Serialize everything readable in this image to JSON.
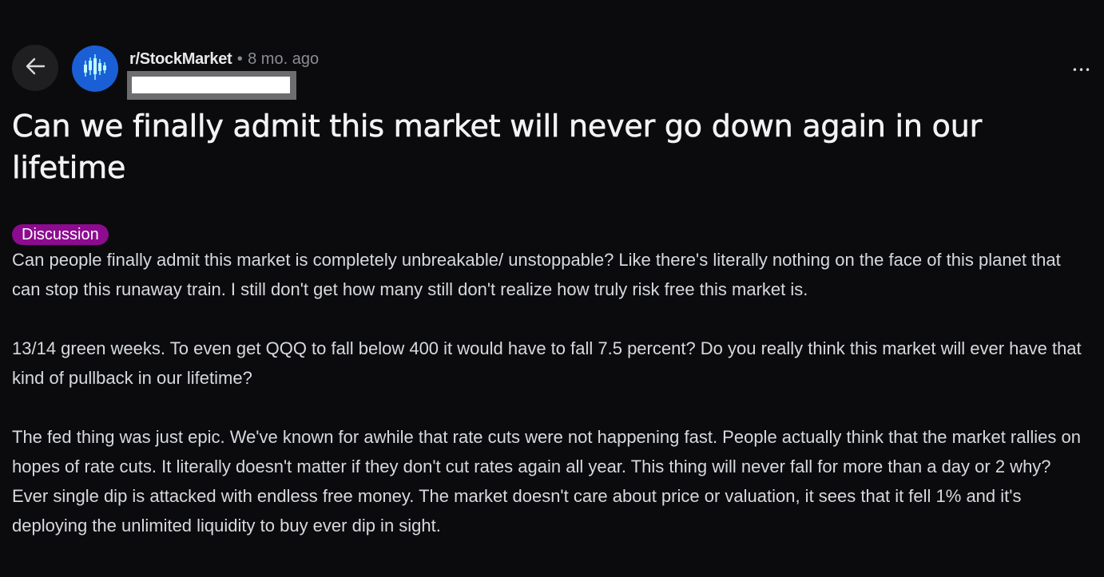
{
  "post": {
    "subreddit": "r/StockMarket",
    "separator": "•",
    "age": "8 mo. ago",
    "more_label": "•••",
    "title": "Can we finally admit this market will never go down again in our lifetime",
    "flair": "Discussion",
    "paragraphs": [
      "Can people finally admit this market is completely unbreakable/ unstoppable? Like there's literally nothing on the face of this planet that can stop this runaway train. I still don't get how many still don't realize how truly risk free this market is.",
      "13/14 green weeks. To even get QQQ to fall below 400 it would have to fall 7.5 percent? Do you really think this market will ever have that kind of pullback in our lifetime?",
      "The fed thing was just epic. We've known for awhile that rate cuts were not happening fast. People actually think that the market rallies on hopes of rate cuts. It literally doesn't matter if they don't cut rates again all year. This thing will never fall for more than a day or 2 why? Ever single dip is attacked with endless free money. The market doesn't care about price or valuation, it sees that it fell 1% and it's deploying the unlimited liquidity to buy ever dip in sight."
    ]
  },
  "icons": {
    "back": "arrow-left-icon",
    "avatar": "candlestick-chart-icon",
    "more": "ellipsis-icon"
  },
  "colors": {
    "background": "#0b0b0e",
    "flair": "#8c0b8f",
    "avatar": "#1a5fd6",
    "text": "#d7dadc",
    "muted": "#8a8d91"
  }
}
